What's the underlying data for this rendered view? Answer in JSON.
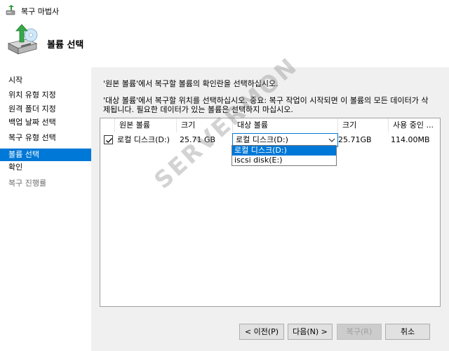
{
  "window": {
    "title": "복구 마법사"
  },
  "header": {
    "title": "볼륨 선택"
  },
  "sidebar": {
    "items": [
      {
        "label": "시작",
        "state": "normal"
      },
      {
        "label": "위치 유형 지정",
        "state": "normal"
      },
      {
        "label": "원격 폴더 지정",
        "state": "normal"
      },
      {
        "label": "백업 날짜 선택",
        "state": "normal"
      },
      {
        "label": "복구 유형 선택",
        "state": "normal"
      },
      {
        "label": "볼륨 선택",
        "state": "active"
      },
      {
        "label": "확인",
        "state": "normal"
      },
      {
        "label": "복구 진행률",
        "state": "disabled"
      }
    ]
  },
  "main": {
    "instruction1": "'원본 볼륨'에서 복구할 볼륨의 확인란을 선택하십시오.",
    "instruction2_line1": "'대상 볼륨'에서 복구할 위치를 선택하십시오. 중요: 복구 작업이 시작되면 이 볼륨의 모든 데이터가 삭",
    "instruction2_line2": "제됩니다. 필요한 데이터가 있는 볼륨은 선택하지 마십시오.",
    "table": {
      "columns": [
        "원본 볼륨",
        "크기",
        "대상 볼륨",
        "크기",
        "사용 중인 ..."
      ],
      "rows": [
        {
          "checked": true,
          "source": "로컬 디스크(D:)",
          "source_size": "25.71 GB",
          "target": "로컬 디스크(D:)",
          "target_size": "25.71GB",
          "used": "114.00MB"
        }
      ]
    },
    "dropdown_options": [
      "로컬 디스크(D:)",
      "iscsi disk(E:)"
    ]
  },
  "buttons": {
    "prev": "< 이전(P)",
    "next": "다음(N) >",
    "recover": "복구(R)",
    "cancel": "취소"
  },
  "watermark": "SERVERMON",
  "colors": {
    "accent": "#0078d7",
    "panel": "#f0f0f0"
  }
}
